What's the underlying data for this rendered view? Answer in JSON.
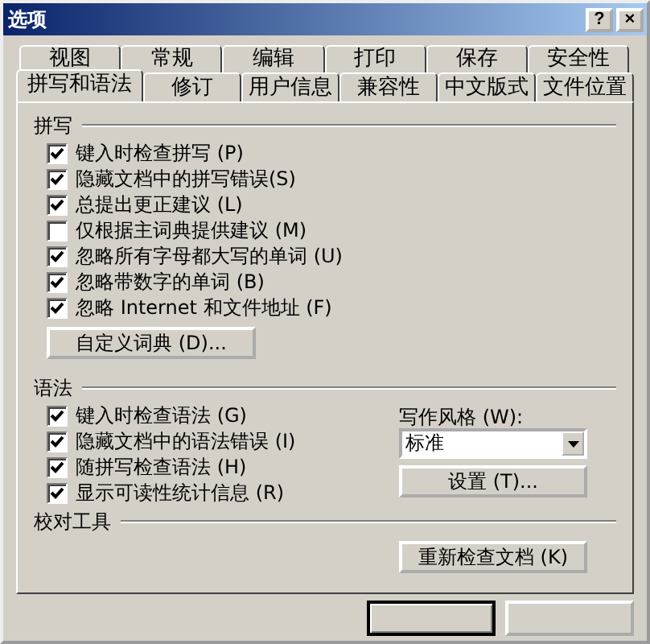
{
  "window": {
    "title": "选项",
    "help_button": "?",
    "close_button": "×"
  },
  "tabs": [
    [
      {
        "label": "视图",
        "selected": false
      },
      {
        "label": "常规",
        "selected": false
      },
      {
        "label": "编辑",
        "selected": false
      },
      {
        "label": "打印",
        "selected": false
      },
      {
        "label": "保存",
        "selected": false
      },
      {
        "label": "安全性",
        "selected": false
      }
    ],
    [
      {
        "label": "拼写和语法",
        "selected": true
      },
      {
        "label": "修订",
        "selected": false
      },
      {
        "label": "用户信息",
        "selected": false
      },
      {
        "label": "兼容性",
        "selected": false
      },
      {
        "label": "中文版式",
        "selected": false
      },
      {
        "label": "文件位置",
        "selected": false
      }
    ]
  ],
  "spelling": {
    "label": "拼写",
    "options": [
      {
        "label": "键入时检查拼写 (P)",
        "checked": true
      },
      {
        "label": "隐藏文档中的拼写错误(S)",
        "checked": true
      },
      {
        "label": "总提出更正建议 (L)",
        "checked": true
      },
      {
        "label": "仅根据主词典提供建议 (M)",
        "checked": false
      },
      {
        "label": "忽略所有字母都大写的单词 (U)",
        "checked": true
      },
      {
        "label": "忽略带数字的单词 (B)",
        "checked": true
      },
      {
        "label": "忽略 Internet 和文件地址 (F)",
        "checked": true
      }
    ],
    "button": "自定义词典 (D)..."
  },
  "grammar": {
    "label": "语法",
    "options": [
      {
        "label": "键入时检查语法 (G)",
        "checked": true
      },
      {
        "label": "隐藏文档中的语法错误 (I)",
        "checked": true
      },
      {
        "label": "随拼写检查语法 (H)",
        "checked": true
      },
      {
        "label": "显示可读性统计信息 (R)",
        "checked": true
      }
    ],
    "style_label": "写作风格 (W):",
    "style_value": "标准",
    "settings_button": "设置 (T)..."
  },
  "proofing": {
    "label": "校对工具",
    "button": "重新检查文档 (K)"
  },
  "footer_buttons": [
    {
      "default": true
    },
    {
      "default": false
    }
  ]
}
